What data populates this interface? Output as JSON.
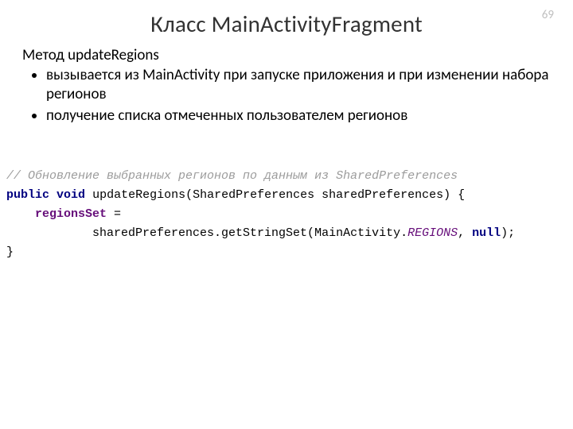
{
  "page_number": "69",
  "title": "Класс MainActivityFragment",
  "intro": "Метод updateRegions",
  "bullets": [
    "вызывается из MainActivity при запуске приложения и при изменении набора регионов",
    "получение списка отмеченных пользователем регионов"
  ],
  "code": {
    "comment": "// Обновление выбранных регионов по данным из SharedPreferences",
    "kw_public": "public",
    "kw_void": "void",
    "method_name": "updateRegions",
    "param": "(SharedPreferences sharedPreferences) {",
    "field": "regionsSet",
    "assign_op": " =",
    "call_part1": "            sharedPreferences.getStringSet(MainActivity.",
    "call_const": "REGIONS",
    "call_part2": ", ",
    "kw_null": "null",
    "call_part3": ");",
    "close_brace": "}"
  }
}
